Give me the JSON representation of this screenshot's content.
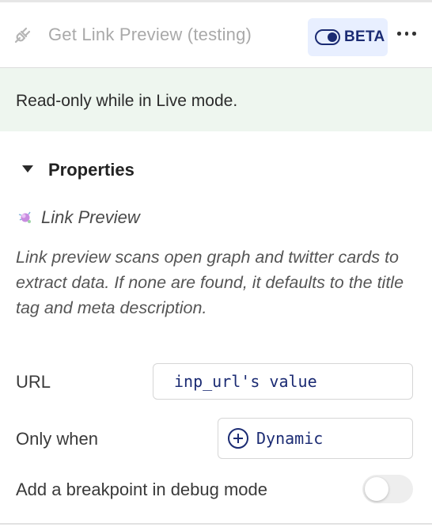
{
  "header": {
    "title": "Get Link Preview (testing)",
    "badge_label": "BETA",
    "icon": "plug-icon",
    "menu_icon": "more-horizontal-icon"
  },
  "banner": {
    "text": "Read-only while in Live mode."
  },
  "properties": {
    "section_title": "Properties",
    "plugin_name": "Link Preview",
    "description": "Link preview scans open graph and twitter cards to extract data. If none are found, it defaults to the title tag and meta description.",
    "fields": {
      "url": {
        "label": "URL",
        "value": "inp_url's value"
      },
      "only_when": {
        "label": "Only when",
        "value": "Dynamic"
      },
      "debug": {
        "label": "Add a breakpoint in debug mode",
        "enabled": false
      }
    }
  },
  "colors": {
    "accent": "#1b2b73",
    "badge_bg": "#e8efff",
    "banner_bg": "#eef6ef",
    "muted_text": "#a9a9a9"
  }
}
